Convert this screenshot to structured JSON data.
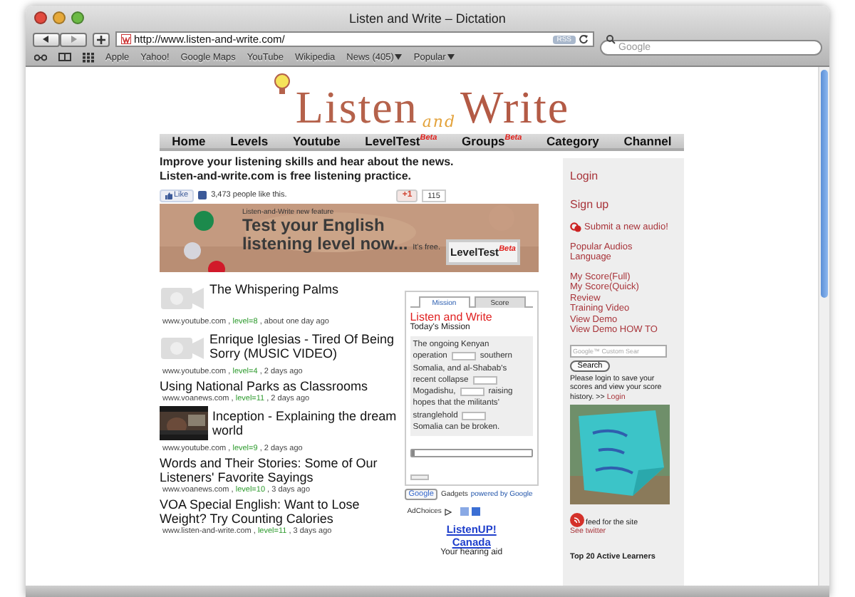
{
  "window": {
    "title": "Listen and Write – Dictation"
  },
  "toolbar": {
    "url": "http://www.listen-and-write.com/",
    "rss": "RSS",
    "search_placeholder": "Google"
  },
  "bookmarks": [
    {
      "label": "Apple",
      "menu": false
    },
    {
      "label": "Yahoo!",
      "menu": false
    },
    {
      "label": "Google Maps",
      "menu": false
    },
    {
      "label": "YouTube",
      "menu": false
    },
    {
      "label": "Wikipedia",
      "menu": false
    },
    {
      "label": "News (405)",
      "menu": true
    },
    {
      "label": "Popular",
      "menu": true
    }
  ],
  "logo": [
    "Listen",
    "and",
    "Write"
  ],
  "nav": [
    {
      "label": "Home"
    },
    {
      "label": "Levels"
    },
    {
      "label": "Youtube"
    },
    {
      "label": "LevelTest",
      "badge": "Beta"
    },
    {
      "label": "Groups",
      "badge": "Beta"
    },
    {
      "label": "Category"
    },
    {
      "label": "Channel"
    }
  ],
  "intro": [
    "Improve your listening skills and hear about the news.",
    "Listen-and-write.com is free listening practice."
  ],
  "social": {
    "like": "Like",
    "like_count": "3,473 people like this.",
    "plusone": "+1",
    "plusone_count": "115"
  },
  "banner": {
    "kicker": "Listen-and-Write new feature",
    "headline": [
      "Test your English",
      "listening level now..."
    ],
    "note": "It's free.",
    "button": "LevelTest",
    "badge": "Beta"
  },
  "articles": [
    {
      "kind": "video",
      "title": "The Whispering Palms",
      "source": "www.youtube.com ,",
      "level": "level=8",
      "age": ", about one day ago"
    },
    {
      "kind": "video",
      "title": "Enrique Iglesias - Tired Of Being Sorry (MUSIC VIDEO)",
      "source": "www.youtube.com ,",
      "level": "level=4",
      "age": ", 2 days ago"
    },
    {
      "kind": "text",
      "title": "Using National Parks as Classrooms",
      "source": "www.voanews.com ,",
      "level": "level=11",
      "age": ", 2 days ago"
    },
    {
      "title": "Inception - Explaining the dream world",
      "source": "www.youtube.com ,",
      "level": "level=9",
      "age": ", 2 days ago"
    },
    {
      "kind": "text",
      "title": "Words and Their Stories: Some of Our Listeners' Favorite Sayings",
      "source": "www.voanews.com ,",
      "level": "level=10",
      "age": ", 3 days ago"
    },
    {
      "kind": "text",
      "title": "VOA Special English: Want to Lose Weight? Try Counting Calories",
      "source": "www.listen-and-write.com ,",
      "level": "level=11",
      "age": ", 3 days ago"
    }
  ],
  "mission": {
    "tabs": [
      {
        "label": "Mission",
        "selected": true
      },
      {
        "label": "Score",
        "selected": false
      }
    ],
    "title": "Listen and Write",
    "subtitle": "Today's Mission",
    "passage": [
      [
        {
          "kind": "text",
          "text": "The ongoing Kenyan"
        }
      ],
      [
        {
          "kind": "text",
          "text": "operation"
        },
        {
          "kind": "blank"
        },
        {
          "kind": "text",
          "text": "southern"
        }
      ],
      [
        {
          "kind": "text",
          "text": "Somalia, and al-Shabab's"
        }
      ],
      [
        {
          "kind": "text",
          "text": "recent collapse"
        },
        {
          "kind": "blank"
        }
      ],
      [
        {
          "kind": "text",
          "text": "Mogadishu,"
        },
        {
          "kind": "blank"
        },
        {
          "kind": "text",
          "text": "raising"
        }
      ],
      [
        {
          "kind": "text",
          "text": "hopes that the militants'"
        }
      ],
      [
        {
          "kind": "text",
          "text": "stranglehold"
        },
        {
          "kind": "blank"
        }
      ],
      [
        {
          "kind": "text",
          "text": "Somalia can be broken."
        }
      ]
    ],
    "progress": {
      "level": 0.03
    }
  },
  "gadgets": {
    "logo": "Google",
    "label": "Gadgets",
    "link": "powered by Google"
  },
  "ads": {
    "label": "AdChoices",
    "title": [
      "ListenUP!",
      "Canada"
    ],
    "body": "Your hearing aid"
  },
  "sidebar": {
    "account": [
      "Login",
      "Sign up"
    ],
    "submit": "Submit a new audio!",
    "browse": [
      "Popular Audios",
      "Language"
    ],
    "tools": [
      "My Score(Full)",
      "My Score(Quick)",
      "Review",
      "Training Video",
      "View Demo",
      "View Demo HOW TO"
    ],
    "search": {
      "placeholder": "Google™ Custom Sear",
      "button": "Search"
    },
    "note": "Please login to save your scores and view your score history. >>",
    "note_link": "Login",
    "feed": "feed for the site",
    "twitter": "See twitter",
    "heading": "Top 20 Active Learners"
  }
}
